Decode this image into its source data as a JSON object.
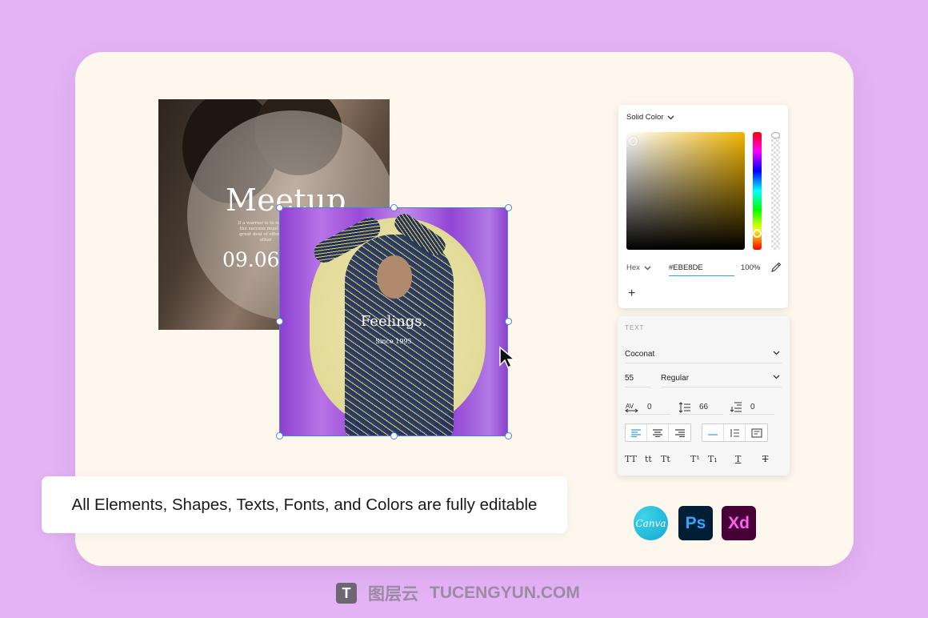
{
  "poster_back": {
    "title": "Meetup",
    "body": "If a warrior is to succeed the success must come great deal of effort b or other",
    "date": "09.06."
  },
  "poster_front": {
    "title": "Feelings.",
    "subtitle": "Since 1995"
  },
  "color_panel": {
    "mode": "Solid Color",
    "format": "Hex",
    "hex": "#EBE8DE",
    "opacity": "100%",
    "add": "+"
  },
  "text_panel": {
    "heading": "TEXT",
    "font": "Coconat",
    "size": "55",
    "weight": "Regular",
    "tracking": "0",
    "line_height": "66",
    "paragraph_spacing": "0",
    "case_options": [
      "TT",
      "tt",
      "Tt",
      "T¹",
      "T₁",
      "T",
      "T"
    ]
  },
  "caption": "All Elements, Shapes, Texts, Fonts, and Colors are fully editable",
  "apps": {
    "canva": "Canva",
    "ps": "Ps",
    "xd": "Xd"
  },
  "watermark": {
    "logo": "T",
    "cn": "图层云",
    "en": "TUCENGYUN.COM"
  },
  "colors": {
    "background": "#E3B3F5",
    "card": "#FDF7EE",
    "selection": "#4B7FE0",
    "accent": "#3AA0E0"
  }
}
